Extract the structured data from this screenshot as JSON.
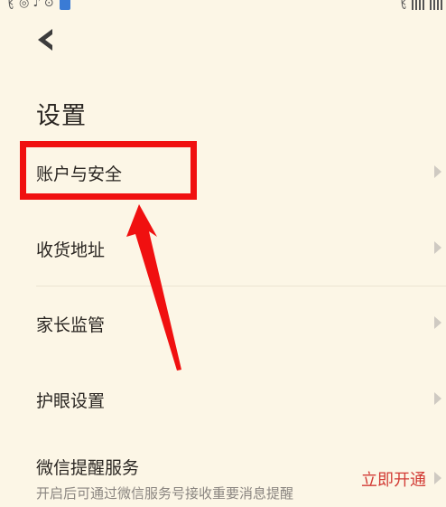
{
  "status_bar": {
    "left_text": "飞",
    "right_text": "飞"
  },
  "header": {
    "back_icon": "chevron-left-icon",
    "title": "设置"
  },
  "menu": {
    "items": [
      {
        "label": "账户与安全",
        "icon": "chevron-right-icon"
      },
      {
        "label": "收货地址",
        "icon": "chevron-right-icon"
      },
      {
        "label": "家长监管",
        "icon": "chevron-right-icon"
      },
      {
        "label": "护眼设置",
        "icon": "chevron-right-icon"
      },
      {
        "label": "微信提醒服务",
        "subtitle": "开启后可通过微信服务号接收重要消息提醒",
        "action": "立即开通",
        "icon": "chevron-right-icon"
      }
    ]
  },
  "colors": {
    "background": "#fcf6e6",
    "text": "#2a2622",
    "highlight": "#f01010",
    "action": "#d23b35",
    "chevron": "#cfcac2"
  }
}
